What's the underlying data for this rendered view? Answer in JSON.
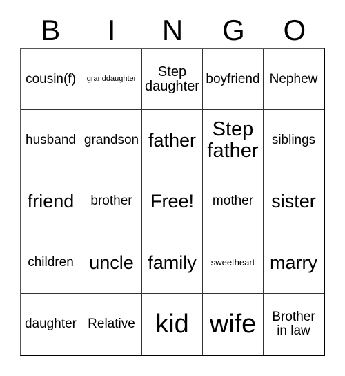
{
  "card": {
    "title_letters": [
      "B",
      "I",
      "N",
      "G",
      "O"
    ],
    "free_space_label": "Free!",
    "rows": [
      [
        {
          "label": "cousin(f)",
          "size": "m"
        },
        {
          "label": "granddaughter",
          "size": "xs"
        },
        {
          "label": "Step\ndaughter",
          "size": "ml"
        },
        {
          "label": "boyfriend",
          "size": "m"
        },
        {
          "label": "Nephew",
          "size": "m"
        }
      ],
      [
        {
          "label": "husband",
          "size": "m"
        },
        {
          "label": "grandson",
          "size": "m"
        },
        {
          "label": "father",
          "size": "xl"
        },
        {
          "label": "Step\nfather",
          "size": "xxl"
        },
        {
          "label": "siblings",
          "size": "m"
        }
      ],
      [
        {
          "label": "friend",
          "size": "xl"
        },
        {
          "label": "brother",
          "size": "m"
        },
        {
          "label": "Free!",
          "size": "xl"
        },
        {
          "label": "mother",
          "size": "m"
        },
        {
          "label": "sister",
          "size": "xl"
        }
      ],
      [
        {
          "label": "children",
          "size": "m"
        },
        {
          "label": "uncle",
          "size": "xl"
        },
        {
          "label": "family",
          "size": "xl"
        },
        {
          "label": "sweetheart",
          "size": "s"
        },
        {
          "label": "marry",
          "size": "xl"
        }
      ],
      [
        {
          "label": "daughter",
          "size": "m"
        },
        {
          "label": "Relative",
          "size": "m"
        },
        {
          "label": "kid",
          "size": "huge"
        },
        {
          "label": "wife",
          "size": "huge"
        },
        {
          "label": "Brother\nin law",
          "size": "m"
        }
      ]
    ]
  },
  "colors": {
    "background": "#ffffff",
    "text": "#000000",
    "grid_line": "#333333",
    "grid_outer": "#000000"
  }
}
